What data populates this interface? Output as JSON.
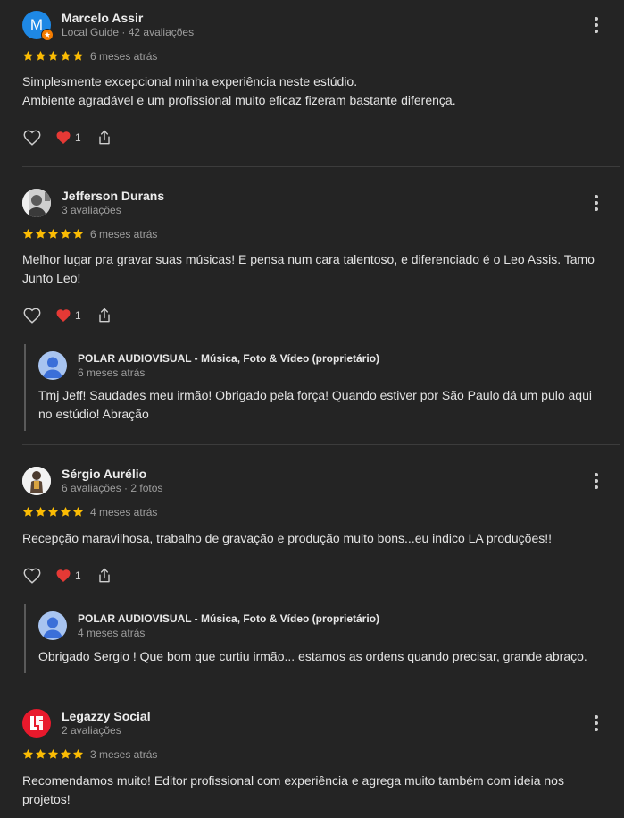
{
  "colors": {
    "background": "#242424",
    "star": "#fbbc04",
    "heart": "#e53935"
  },
  "reviews": [
    {
      "name": "Marcelo Assir",
      "meta": "Local Guide · 42 avaliações",
      "avatar": {
        "type": "letter",
        "letter": "M",
        "color": "#1e88e5",
        "badge": "local-guide-star-icon"
      },
      "rating": 5,
      "date": "6 meses atrás",
      "text_lines": [
        "Simplesmente excepcional minha experiência neste estúdio.",
        "Ambiente agradável e um profissional muito eficaz fizeram bastante diferença."
      ],
      "reactions": {
        "heart_count": "1"
      }
    },
    {
      "name": "Jefferson Durans",
      "meta": "3 avaliações",
      "avatar": {
        "type": "photo",
        "description": "user-photo"
      },
      "rating": 5,
      "date": "6 meses atrás",
      "text_lines": [
        "Melhor lugar pra gravar suas músicas! E pensa num cara talentoso, e diferenciado é o Leo Assis. Tamo",
        "Junto Leo!"
      ],
      "reactions": {
        "heart_count": "1"
      },
      "owner_reply": {
        "name": "POLAR AUDIOVISUAL - Música, Foto & Vídeo (proprietário)",
        "date": "6 meses atrás",
        "text_lines": [
          "Tmj Jeff! Saudades meu irmão! Obrigado pela força! Quando estiver por São Paulo dá um pulo aqui",
          "no estúdio! Abração"
        ]
      }
    },
    {
      "name": "Sérgio Aurélio",
      "meta": "6 avaliações · 2 fotos",
      "avatar": {
        "type": "photo",
        "description": "user-photo"
      },
      "rating": 5,
      "date": "4 meses atrás",
      "text_lines": [
        "Recepção maravilhosa, trabalho de gravação e produção muito bons...eu indico LA produções!!"
      ],
      "reactions": {
        "heart_count": "1"
      },
      "owner_reply": {
        "name": "POLAR AUDIOVISUAL - Música, Foto & Vídeo (proprietário)",
        "date": "4 meses atrás",
        "text_lines": [
          "Obrigado Sergio ! Que bom que curtiu irmão... estamos as ordens quando precisar, grande abraço."
        ]
      }
    },
    {
      "name": "Legazzy Social",
      "meta": "2 avaliações",
      "avatar": {
        "type": "logo",
        "color": "#e8192c"
      },
      "rating": 5,
      "date": "3 meses atrás",
      "text_lines": [
        "Recomendamos muito! Editor profissional com experiência e agrega muito também com ideia nos",
        "projetos!"
      ]
    }
  ]
}
